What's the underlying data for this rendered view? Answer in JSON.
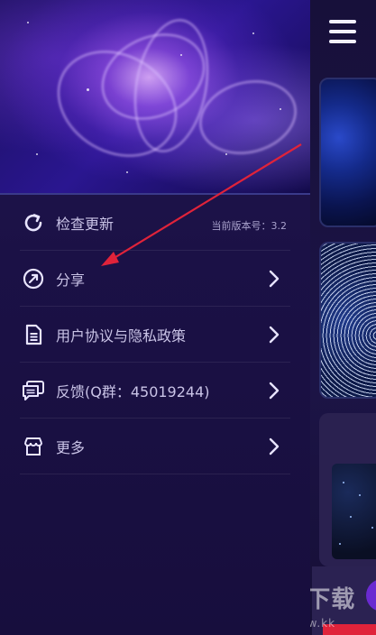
{
  "drawer": {
    "items": [
      {
        "label": "检查更新",
        "icon": "refresh-icon",
        "version_text": "当前版本号：3.2"
      },
      {
        "label": "分享",
        "icon": "share-icon"
      },
      {
        "label": "用户协议与隐私政策",
        "icon": "document-icon"
      },
      {
        "label": "反馈(Q群：45019244)",
        "icon": "feedback-icon"
      },
      {
        "label": "更多",
        "icon": "store-icon"
      }
    ]
  },
  "watermark": {
    "text": "KK下载",
    "sub": "www.kk"
  },
  "colors": {
    "background": "#180c3a",
    "drawer": "#1b1146",
    "text": "#c9c3e6",
    "annotation_arrow": "#e0233a"
  }
}
